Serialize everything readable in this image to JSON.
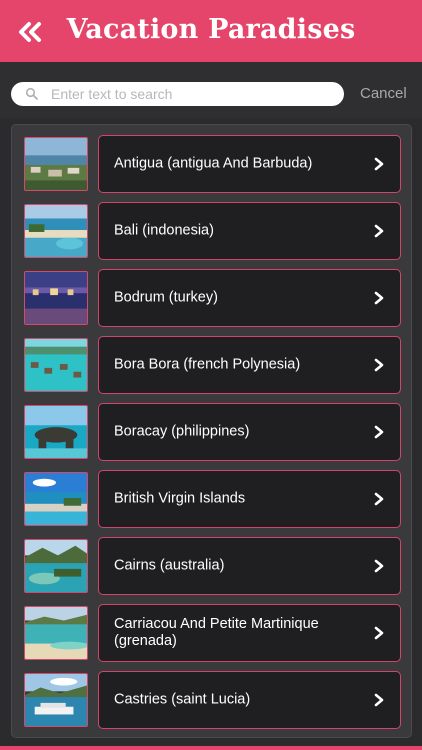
{
  "header": {
    "title": "Vacation Paradises",
    "back_icon": "double-chevron-left-icon",
    "background_color": "#e5456b"
  },
  "search": {
    "placeholder": "Enter text to search",
    "value": "",
    "cancel_label": "Cancel",
    "icon": "search-icon"
  },
  "accent_color": "#d2456a",
  "items": [
    {
      "label": "Antigua (antigua And Barbuda)",
      "icon": "chevron-right-icon"
    },
    {
      "label": "Bali (indonesia)",
      "icon": "chevron-right-icon"
    },
    {
      "label": "Bodrum (turkey)",
      "icon": "chevron-right-icon"
    },
    {
      "label": "Bora Bora (french Polynesia)",
      "icon": "chevron-right-icon"
    },
    {
      "label": "Boracay (philippines)",
      "icon": "chevron-right-icon"
    },
    {
      "label": "British Virgin Islands",
      "icon": "chevron-right-icon"
    },
    {
      "label": "Cairns (australia)",
      "icon": "chevron-right-icon"
    },
    {
      "label": "Carriacou And Petite Martinique (grenada)",
      "icon": "chevron-right-icon"
    },
    {
      "label": "Castries (saint Lucia)",
      "icon": "chevron-right-icon"
    }
  ]
}
